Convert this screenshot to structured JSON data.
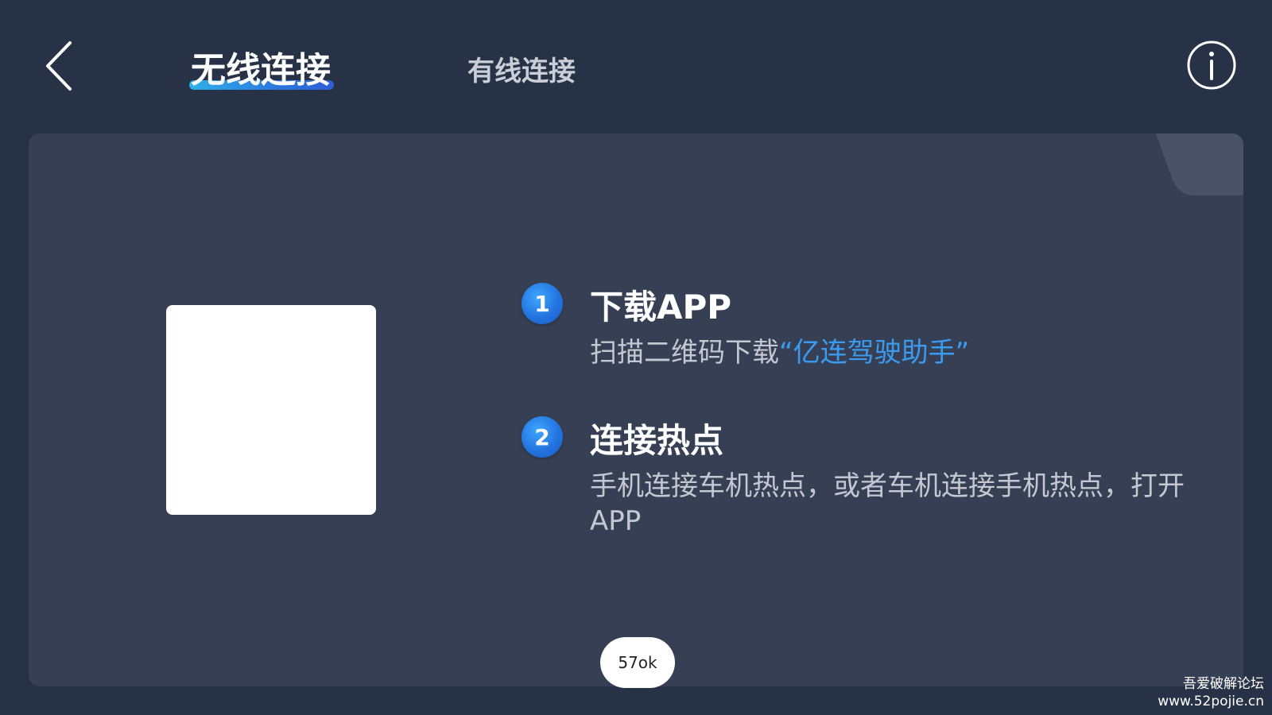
{
  "header": {
    "back_icon": "chevron-left-icon",
    "tabs": [
      {
        "label": "无线连接",
        "active": true
      },
      {
        "label": "有线连接",
        "active": false
      }
    ],
    "info_icon": "info-circle-icon"
  },
  "main": {
    "qr_code": "qr-code-placeholder",
    "steps": [
      {
        "number": "1",
        "title": "下载APP",
        "desc_prefix": "扫描二维码下载",
        "desc_highlight": "“亿连驾驶助手”"
      },
      {
        "number": "2",
        "title": "连接热点",
        "desc": "手机连接车机热点，或者车机连接手机热点，打开APP"
      }
    ]
  },
  "toast": {
    "text": "57ok"
  },
  "watermark": {
    "line1": "吾爱破解论坛",
    "line2": "www.52pojie.cn"
  },
  "colors": {
    "background": "#283247",
    "card": "#373f54",
    "accent": "#2a78e0",
    "highlight_text": "#3a9cf0"
  }
}
